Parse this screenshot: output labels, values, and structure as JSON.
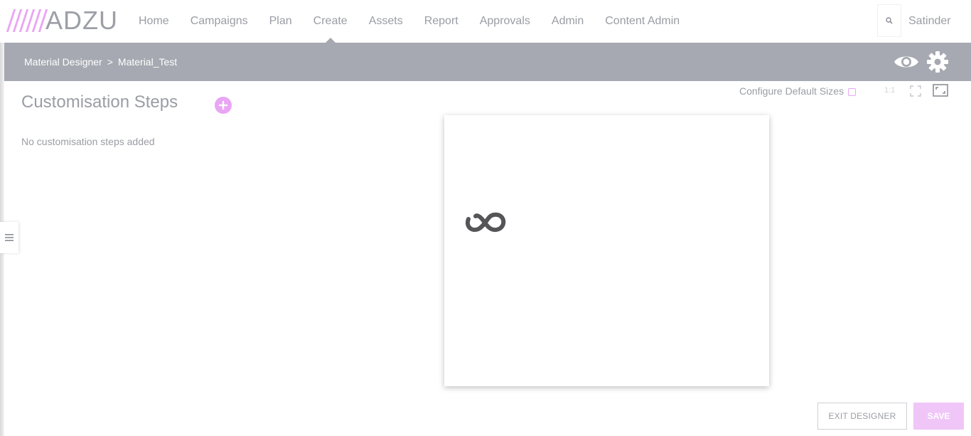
{
  "app": {
    "logo_text": "ADZU",
    "brand_color": "#e9a6f4",
    "nav_items": [
      {
        "label": "Home"
      },
      {
        "label": "Campaigns"
      },
      {
        "label": "Plan"
      },
      {
        "label": "Create",
        "active": true
      },
      {
        "label": "Assets"
      },
      {
        "label": "Report"
      },
      {
        "label": "Approvals"
      },
      {
        "label": "Admin"
      },
      {
        "label": "Content Admin"
      }
    ],
    "search_icon": "search-icon",
    "user_name": "Satinder"
  },
  "subbar": {
    "breadcrumb_root": "Material Designer",
    "breadcrumb_separator": ">",
    "breadcrumb_current": "Material_Test",
    "preview_icon": "eye-icon",
    "settings_icon": "gear-icon",
    "background_color": "#a6a9b1"
  },
  "steps": {
    "title": "Customisation Steps",
    "add_icon": "plus-circle-icon",
    "empty_text": "No customisation steps added"
  },
  "canvas_tools": {
    "configure_label": "Configure Default Sizes",
    "configure_checked": false,
    "ratio_label": "1:1",
    "fit_icon": "fullscreen-icon",
    "resize_icon": "resize-icon"
  },
  "canvas": {
    "logo_icon": "infinity-logo-icon"
  },
  "actions": {
    "exit_label": "EXIT DESIGNER",
    "save_label": "SAVE"
  }
}
